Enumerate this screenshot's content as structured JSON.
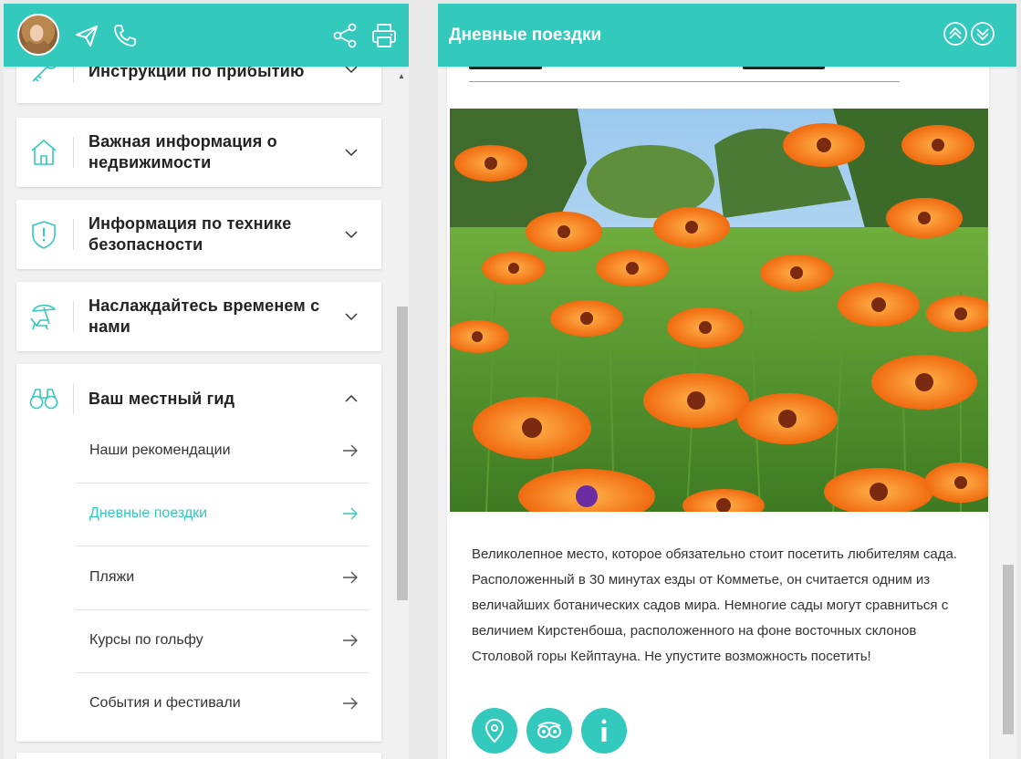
{
  "left": {
    "header": {
      "icons": [
        "avatar",
        "send-icon",
        "phone-icon",
        "share-icon",
        "print-icon"
      ]
    },
    "sections": [
      {
        "title": "Инструкции по прибытию",
        "icon": "key-icon"
      },
      {
        "title": "Важная информация о недвижимости",
        "icon": "house-icon"
      },
      {
        "title": "Информация по технике безопасности",
        "icon": "shield-alert-icon"
      },
      {
        "title": "Наслаждайтесь временем с нами",
        "icon": "beach-chair-icon"
      },
      {
        "title": "Ваш местный гид",
        "icon": "binoculars-icon",
        "expanded": true
      }
    ],
    "guide_items": [
      {
        "label": "Наши рекомендации",
        "active": false
      },
      {
        "label": "Дневные поездки",
        "active": true
      },
      {
        "label": "Пляжи",
        "active": false
      },
      {
        "label": "Курсы по гольфу",
        "active": false
      },
      {
        "label": "События и фестивали",
        "active": false
      }
    ]
  },
  "right": {
    "title": "Дневные поездки",
    "description": "Великолепное место, которое обязательно стоит посетить любителям сада. Расположенный в 30 минутах езды от Комметье, он считается одним из величайших ботанических садов мира. Немногие сады могут сравниться с величием Кирстенбоша, расположенного на фоне восточных склонов Столовой горы Кейптауна. Не упустите возможность посетить!",
    "actions": [
      "map-pin-icon",
      "tripadvisor-icon",
      "info-icon"
    ]
  },
  "colors": {
    "accent": "#33c9bd",
    "text": "#222222"
  }
}
